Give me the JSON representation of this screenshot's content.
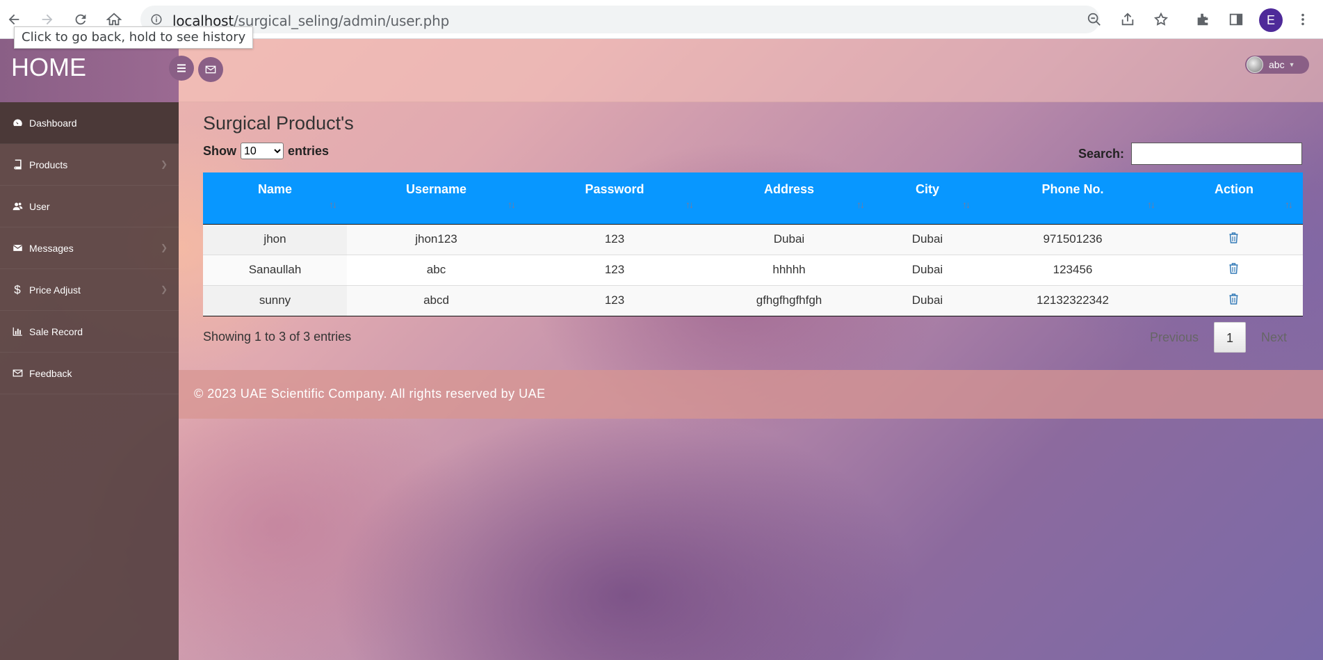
{
  "browser": {
    "url_host": "localhost",
    "url_path": "/surgical_seling/admin/user.php",
    "tooltip": "Click to go back, hold to see history",
    "profile_initial": "E"
  },
  "sidebar": {
    "brand": "HOME",
    "items": [
      {
        "label": "Dashboard",
        "icon": "dashboard-icon",
        "has_submenu": false
      },
      {
        "label": "Products",
        "icon": "book-icon",
        "has_submenu": true
      },
      {
        "label": "User",
        "icon": "users-icon",
        "has_submenu": false
      },
      {
        "label": "Messages",
        "icon": "envelope-icon",
        "has_submenu": true
      },
      {
        "label": "Price Adjust",
        "icon": "dollar-icon",
        "has_submenu": true
      },
      {
        "label": "Sale Record",
        "icon": "bar-chart-icon",
        "has_submenu": false
      },
      {
        "label": "Feedback",
        "icon": "envelope-outline-icon",
        "has_submenu": false
      }
    ]
  },
  "topnav": {
    "username": "abc"
  },
  "main": {
    "title": "Surgical Product's",
    "show_label": "Show",
    "entries_label": "entries",
    "page_length": "10",
    "search_label": "Search:",
    "search_value": "",
    "table": {
      "columns": [
        "Name",
        "Username",
        "Password",
        "Address",
        "City",
        "Phone No.",
        "Action"
      ],
      "rows": [
        [
          "jhon",
          "jhon123",
          "123",
          "Dubai",
          "Dubai",
          "971501236"
        ],
        [
          "Sanaullah",
          "abc",
          "123",
          "hhhhh",
          "Dubai",
          "123456"
        ],
        [
          "sunny",
          "abcd",
          "123",
          "gfhgfhgfhfgh",
          "Dubai",
          "12132322342"
        ]
      ]
    },
    "info": "Showing 1 to 3 of 3 entries",
    "pagination": {
      "previous": "Previous",
      "current": "1",
      "next": "Next"
    }
  },
  "footer": {
    "text": "© 2023 UAE Scientific Company. All rights reserved by UAE"
  },
  "colors": {
    "table_header": "#0897ff",
    "sidebar_brand": "#8a5f86",
    "action_icon": "#337ab7"
  }
}
